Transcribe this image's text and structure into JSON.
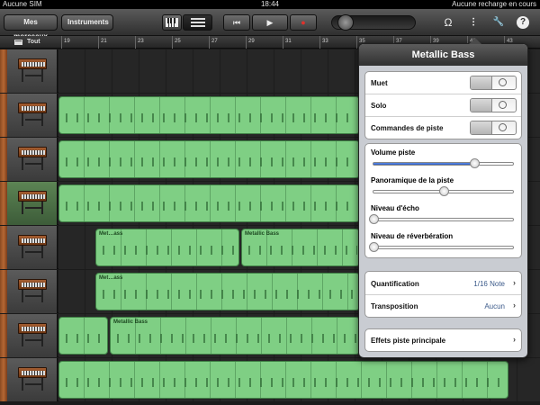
{
  "status": {
    "carrier": "Aucune SIM",
    "time": "18:44",
    "battery": "Aucune recharge en cours"
  },
  "toolbar": {
    "songs_label": "Mes morceaux",
    "instruments_label": "Instruments",
    "view_keyboard_icon": "piano-keys-icon",
    "view_tracks_icon": "track-list-icon",
    "rewind_icon": "rewind-icon",
    "play_icon": "play-icon",
    "record_icon": "record-icon",
    "metronome_icon": "loop-icon",
    "mixer_icon": "mixer-icon",
    "settings_icon": "wrench-icon",
    "help_icon": "help-icon",
    "rewind_glyph": "⏮",
    "play_glyph": "▶",
    "record_glyph": "●",
    "loop_glyph": "Ω",
    "mixer_glyph": "⫶",
    "wrench_glyph": "🔧",
    "help_glyph": "?"
  },
  "ruler": {
    "all_label": "Tout",
    "ticks": [
      "19",
      "21",
      "23",
      "25",
      "27",
      "29",
      "31",
      "33",
      "35",
      "37",
      "39",
      "41",
      "43"
    ]
  },
  "tracks": [
    {
      "selected": false,
      "regions": []
    },
    {
      "selected": false,
      "regions": [
        {
          "start": 0,
          "width": 335,
          "name": ""
        }
      ]
    },
    {
      "selected": false,
      "regions": [
        {
          "start": 0,
          "width": 335,
          "name": ""
        }
      ]
    },
    {
      "selected": true,
      "regions": [
        {
          "start": 0,
          "width": 335,
          "name": ""
        }
      ]
    },
    {
      "selected": false,
      "regions": [
        {
          "start": 41,
          "width": 160,
          "name": "Met…ass"
        },
        {
          "start": 203,
          "width": 132,
          "name": "Metallic Bass"
        }
      ]
    },
    {
      "selected": false,
      "regions": [
        {
          "start": 41,
          "width": 294,
          "name": "Met…ass"
        }
      ]
    },
    {
      "selected": false,
      "regions": [
        {
          "start": 0,
          "width": 55,
          "name": ""
        },
        {
          "start": 57,
          "width": 278,
          "name": "Metallic Bass"
        }
      ]
    },
    {
      "selected": false,
      "regions": [
        {
          "start": 0,
          "width": 500,
          "name": ""
        }
      ]
    }
  ],
  "panel": {
    "title": "Metallic Bass",
    "mute_label": "Muet",
    "solo_label": "Solo",
    "track_controls_label": "Commandes de piste",
    "switch_off": "O",
    "volume_label": "Volume piste",
    "volume": 0.72,
    "pan_label": "Panoramique de la piste",
    "pan": 0.5,
    "echo_label": "Niveau d'écho",
    "echo": 0.0,
    "reverb_label": "Niveau de réverbération",
    "reverb": 0.0,
    "quant_label": "Quantification",
    "quant_value": "1/16 Note",
    "transpose_label": "Transposition",
    "transpose_value": "Aucun",
    "master_fx_label": "Effets piste principale",
    "chevron": "›"
  }
}
